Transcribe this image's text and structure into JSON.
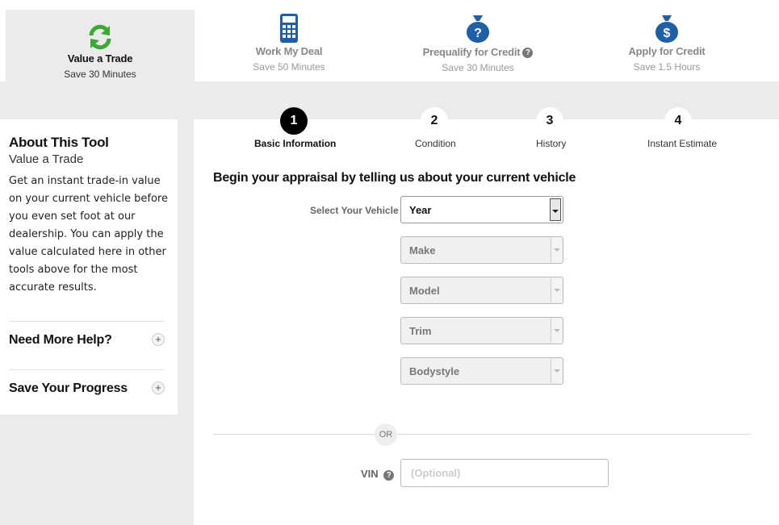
{
  "tabs": [
    {
      "title": "Value a Trade",
      "sub": "Save 30 Minutes",
      "icon": "refresh-icon",
      "color": "#3aaa35"
    },
    {
      "title": "Work My Deal",
      "sub": "Save 50 Minutes",
      "icon": "calculator-icon",
      "color": "#1f5fa8"
    },
    {
      "title": "Prequalify for Credit",
      "sub": "Save 30 Minutes",
      "icon": "money-bag-question-icon",
      "color": "#1f5fa8"
    },
    {
      "title": "Apply for Credit",
      "sub": "Save 1.5 Hours",
      "icon": "money-bag-dollar-icon",
      "color": "#1f5fa8"
    }
  ],
  "sidebar": {
    "title": "About This Tool",
    "subtitle": "Value a Trade",
    "description": "Get an instant trade-in value on your current vehicle before you even set foot at our dealership. You can apply the value calculated here in other tools above for the most accurate results.",
    "help_label": "Need More Help?",
    "progress_label": "Save Your Progress"
  },
  "steps": [
    {
      "num": "1",
      "label": "Basic Information"
    },
    {
      "num": "2",
      "label": "Condition"
    },
    {
      "num": "3",
      "label": "History"
    },
    {
      "num": "4",
      "label": "Instant Estimate"
    }
  ],
  "form": {
    "heading": "Begin your appraisal by telling us about your current vehicle",
    "select_label": "Select Your Vehicle",
    "year": "Year",
    "make": "Make",
    "model": "Model",
    "trim": "Trim",
    "bodystyle": "Bodystyle",
    "or": "OR",
    "vin_label": "VIN",
    "vin_placeholder": "(Optional)"
  },
  "colors": {
    "accent_green": "#3aaa35",
    "accent_blue": "#1f5fa8",
    "band": "#ebebeb"
  }
}
